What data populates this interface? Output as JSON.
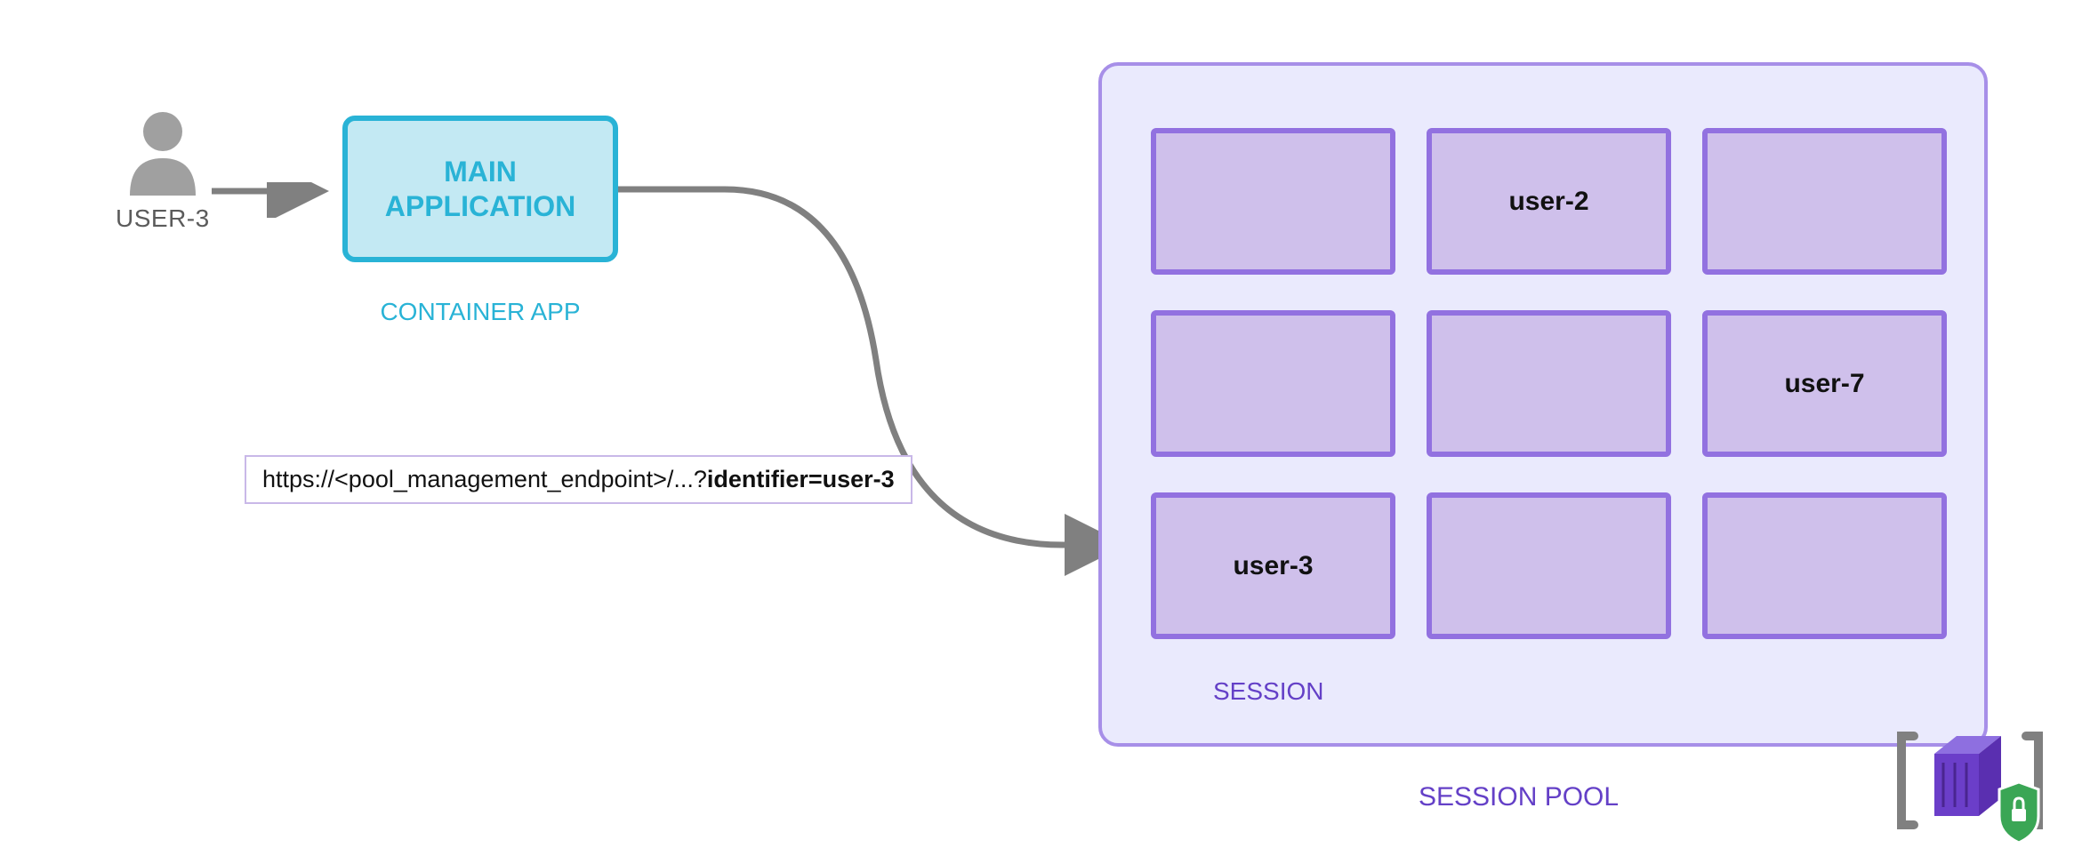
{
  "user": {
    "label": "USER-3"
  },
  "mainApp": {
    "line1": "MAIN",
    "line2": "APPLICATION",
    "caption": "CONTAINER APP"
  },
  "url": {
    "prefix": "https://<pool_management_endpoint>/...?",
    "bold": "identifier=user-3"
  },
  "sessionPool": {
    "title": "SESSION POOL",
    "sessionLabel": "SESSION",
    "cells": [
      {
        "label": ""
      },
      {
        "label": "user-2"
      },
      {
        "label": ""
      },
      {
        "label": ""
      },
      {
        "label": ""
      },
      {
        "label": "user-7"
      },
      {
        "label": "user-3"
      },
      {
        "label": ""
      },
      {
        "label": ""
      }
    ]
  }
}
